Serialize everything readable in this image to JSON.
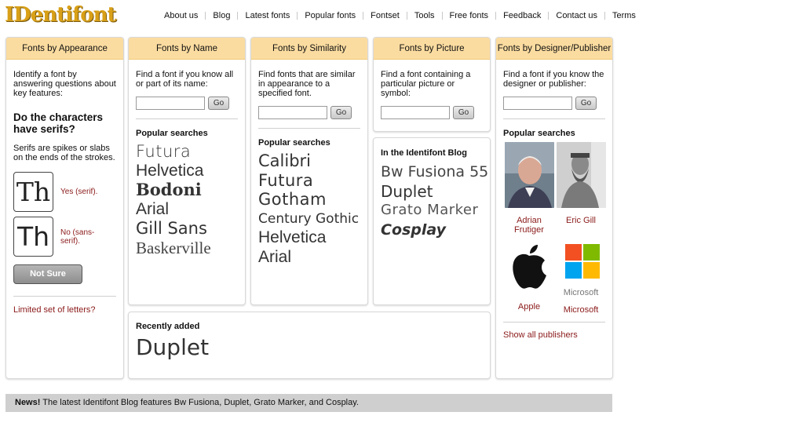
{
  "header": {
    "logo_text": "IDentifont",
    "nav": [
      "About us",
      "Blog",
      "Latest fonts",
      "Popular fonts",
      "Fontset",
      "Tools",
      "Free fonts",
      "Feedback",
      "Contact us",
      "Terms"
    ]
  },
  "appearance": {
    "title": "Fonts by Appearance",
    "intro": "Identify a font by answering questions about key features:",
    "question": "Do the characters have serifs?",
    "explain": "Serifs are spikes or slabs on the ends of the strokes.",
    "glyph": "Th",
    "yes_label": "Yes (serif).",
    "no_label": "No (sans-serif).",
    "not_sure": "Not Sure",
    "limited_link": "Limited set of letters?"
  },
  "by_name": {
    "title": "Fonts by Name",
    "intro": "Find a font if you know all or part of its name:",
    "go": "Go",
    "popular_title": "Popular searches",
    "fonts": [
      "Futura",
      "Helvetica",
      "Bodoni",
      "Arial",
      "Gill Sans",
      "Baskerville"
    ]
  },
  "similarity": {
    "title": "Fonts by Similarity",
    "intro": "Find fonts that are similar in appearance to a specified font.",
    "go": "Go",
    "popular_title": "Popular searches",
    "fonts": [
      "Calibri",
      "Futura",
      "Gotham",
      "Century Gothic",
      "Helvetica",
      "Arial"
    ]
  },
  "picture": {
    "title": "Fonts by Picture",
    "intro": "Find a font containing a particular picture or symbol:",
    "go": "Go"
  },
  "blog": {
    "title": "In the Identifont Blog",
    "fonts": [
      "Bw Fusiona 55",
      "Duplet",
      "Grato Marker",
      "Cosplay"
    ]
  },
  "recent": {
    "title": "Recently added",
    "font": "Duplet"
  },
  "designer": {
    "title": "Fonts by Designer/Publisher",
    "intro": "Find a font if you know the designer or publisher:",
    "go": "Go",
    "popular_title": "Popular searches",
    "items": [
      "Adrian Frutiger",
      "Eric Gill",
      "Apple",
      "Microsoft"
    ],
    "microsoft_word": "Microsoft",
    "show_all": "Show all publishers"
  },
  "news": {
    "label": "News!",
    "text": " The latest Identifont Blog features Bw Fusiona, Duplet, Grato Marker, and Cosplay."
  },
  "colors": {
    "header_bg": "#fbdca0",
    "link": "#8b1a1a",
    "news_bg": "#cfcfcf"
  }
}
